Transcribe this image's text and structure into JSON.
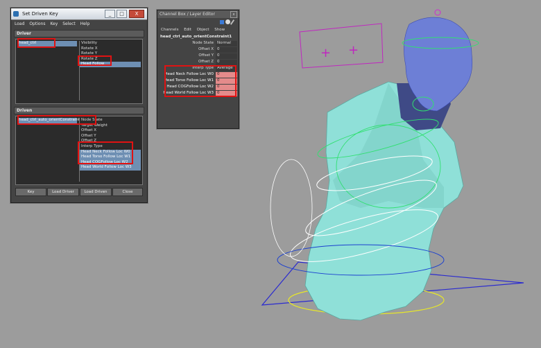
{
  "set_driven_key": {
    "title": "Set Driven Key",
    "menu": [
      "Load",
      "Options",
      "Key",
      "Select",
      "Help"
    ],
    "driver_section": "Driver",
    "driver_objects": [
      "head_ctrl"
    ],
    "driver_attributes": [
      "Visibility",
      "Rotate X",
      "Rotate Y",
      "Rotate Z",
      "Head Follow"
    ],
    "driver_selected_attribute": "Head Follow",
    "driven_section": "Driven",
    "driven_objects": [
      "head_ctrl_auto_orientConstraint1"
    ],
    "driven_attributes": [
      "Node State",
      "Target Weight",
      "Offset X",
      "Offset Y",
      "Offset Z",
      "Interp Type",
      "Head Neck Follow Loc W0",
      "Head Torso Follow Loc W1",
      "Head COGFollow Loc W2",
      "Head World Follow Loc W3"
    ],
    "driven_selected_attributes": [
      "Head Neck Follow Loc W0",
      "Head Torso Follow Loc W1",
      "Head COGFollow Loc W2",
      "Head World Follow Loc W3"
    ],
    "buttons": {
      "key": "Key",
      "load_driver": "Load Driver",
      "load_driven": "Load Driven",
      "close": "Close"
    },
    "window_buttons": {
      "minimize": "_",
      "maximize": "□",
      "close": "X"
    }
  },
  "channel_box": {
    "title": "Channel Box / Layer Editor",
    "menu": [
      "Channels",
      "Edit",
      "Object",
      "Show"
    ],
    "object_name": "head_ctrl_auto_orientConstraint1",
    "channels": [
      {
        "name": "Node State",
        "value": "Normal"
      },
      {
        "name": "Offset X",
        "value": "0"
      },
      {
        "name": "Offset Y",
        "value": "0"
      },
      {
        "name": "Offset Z",
        "value": "0"
      },
      {
        "name": "Interp Type",
        "value": "Average"
      },
      {
        "name": "Head Neck Follow Loc W0",
        "value": "0"
      },
      {
        "name": "Head Torso Follow Loc W1",
        "value": "0"
      },
      {
        "name": "Head COGFollow Loc W2",
        "value": "0"
      },
      {
        "name": "Head World Follow Loc W3",
        "value": "0"
      }
    ],
    "close_glyph": "x"
  },
  "colors": {
    "viewport_bg": "#9c9c9c",
    "body_mesh": "#8fe0d8",
    "head_mesh": "#6d7fd6",
    "highlight_red": "#e11212",
    "selection_blue": "#6e8fb3"
  }
}
